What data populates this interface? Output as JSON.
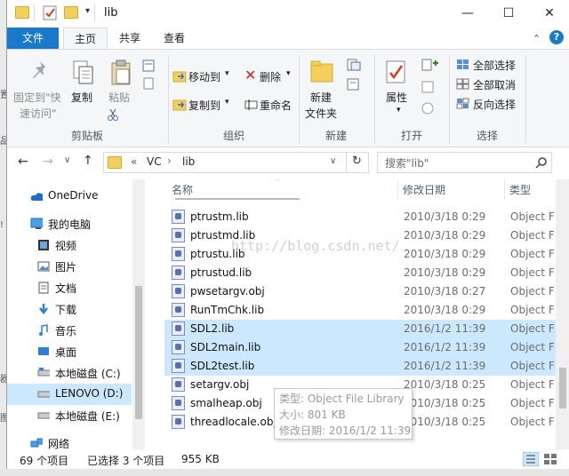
{
  "window": {
    "title": "lib",
    "minimize": "—",
    "maximize": "☐",
    "close": "✕"
  },
  "ribbon_tabs": [
    "文件",
    "主页",
    "共享",
    "查看"
  ],
  "ribbon": {
    "clipboard": {
      "pin": "固定到\"快\n速访问\"",
      "pin_line1": "固定到\"快",
      "pin_line2": "速访问\"",
      "copy": "复制",
      "paste": "粘贴",
      "group": "剪贴板"
    },
    "organize": {
      "move_to": "移动到",
      "copy_to": "复制到",
      "delete": "删除",
      "rename": "重命名",
      "group": "组织"
    },
    "new": {
      "new_folder_line1": "新建",
      "new_folder_line2": "文件夹",
      "group": "新建"
    },
    "open": {
      "properties": "属性",
      "group": "打开"
    },
    "select": {
      "select_all": "全部选择",
      "select_none": "全部取消",
      "invert": "反向选择",
      "group": "选择"
    }
  },
  "address": {
    "chevron": "«",
    "crumbs": [
      "VC",
      "lib"
    ],
    "search_placeholder": "搜索\"lib\""
  },
  "nav": [
    {
      "label": "OneDrive",
      "icon": "cloud-icon"
    },
    {
      "label": "我的电脑",
      "icon": "computer-icon"
    },
    {
      "label": "视频",
      "icon": "video-icon"
    },
    {
      "label": "图片",
      "icon": "picture-icon"
    },
    {
      "label": "文档",
      "icon": "document-icon"
    },
    {
      "label": "下载",
      "icon": "download-icon"
    },
    {
      "label": "音乐",
      "icon": "music-icon"
    },
    {
      "label": "桌面",
      "icon": "desktop-icon"
    },
    {
      "label": "本地磁盘 (C:)",
      "icon": "drive-icon"
    },
    {
      "label": "LENOVO (D:)",
      "icon": "drive-icon"
    },
    {
      "label": "本地磁盘 (E:)",
      "icon": "drive-icon"
    },
    {
      "label": "网络",
      "icon": "network-icon"
    }
  ],
  "columns": [
    "名称",
    "修改日期",
    "类型"
  ],
  "files": [
    {
      "name": "ptrustm.lib",
      "date": "2010/3/18 0:29",
      "type": "Object F",
      "selected": false
    },
    {
      "name": "ptrustmd.lib",
      "date": "2010/3/18 0:29",
      "type": "Object F",
      "selected": false
    },
    {
      "name": "ptrustu.lib",
      "date": "2010/3/18 0:29",
      "type": "Object F",
      "selected": false
    },
    {
      "name": "ptrustud.lib",
      "date": "2010/3/18 0:29",
      "type": "Object F",
      "selected": false
    },
    {
      "name": "pwsetargv.obj",
      "date": "2010/3/18 0:27",
      "type": "Object F",
      "selected": false
    },
    {
      "name": "RunTmChk.lib",
      "date": "2010/3/18 0:29",
      "type": "Object F",
      "selected": false
    },
    {
      "name": "SDL2.lib",
      "date": "2016/1/2 11:39",
      "type": "Object F",
      "selected": true
    },
    {
      "name": "SDL2main.lib",
      "date": "2016/1/2 11:39",
      "type": "Object F",
      "selected": true
    },
    {
      "name": "SDL2test.lib",
      "date": "2016/1/2 11:39",
      "type": "Object F",
      "selected": true
    },
    {
      "name": "setargv.obj",
      "date": "2010/3/18 0:25",
      "type": "Object F",
      "selected": false
    },
    {
      "name": "smalheap.obj",
      "date": "2010/3/18 0:25",
      "type": "Object F",
      "selected": false
    },
    {
      "name": "threadlocale.obj",
      "date": "2010/3/18 0:25",
      "type": "Object F",
      "selected": false
    }
  ],
  "watermark": "http://blog.csdn.net/",
  "tooltip": {
    "type": "类型: Object File Library",
    "size": "大小: 801 KB",
    "modified": "修改日期: 2016/1/2 11:39"
  },
  "status": {
    "count": "69 个项目",
    "selected": "已选择 3 个项目",
    "size": "955 KB"
  },
  "colors": {
    "file_tab": "#1979ca",
    "selection": "#cce8ff",
    "ribbon_bg": "#f5f6f7"
  }
}
